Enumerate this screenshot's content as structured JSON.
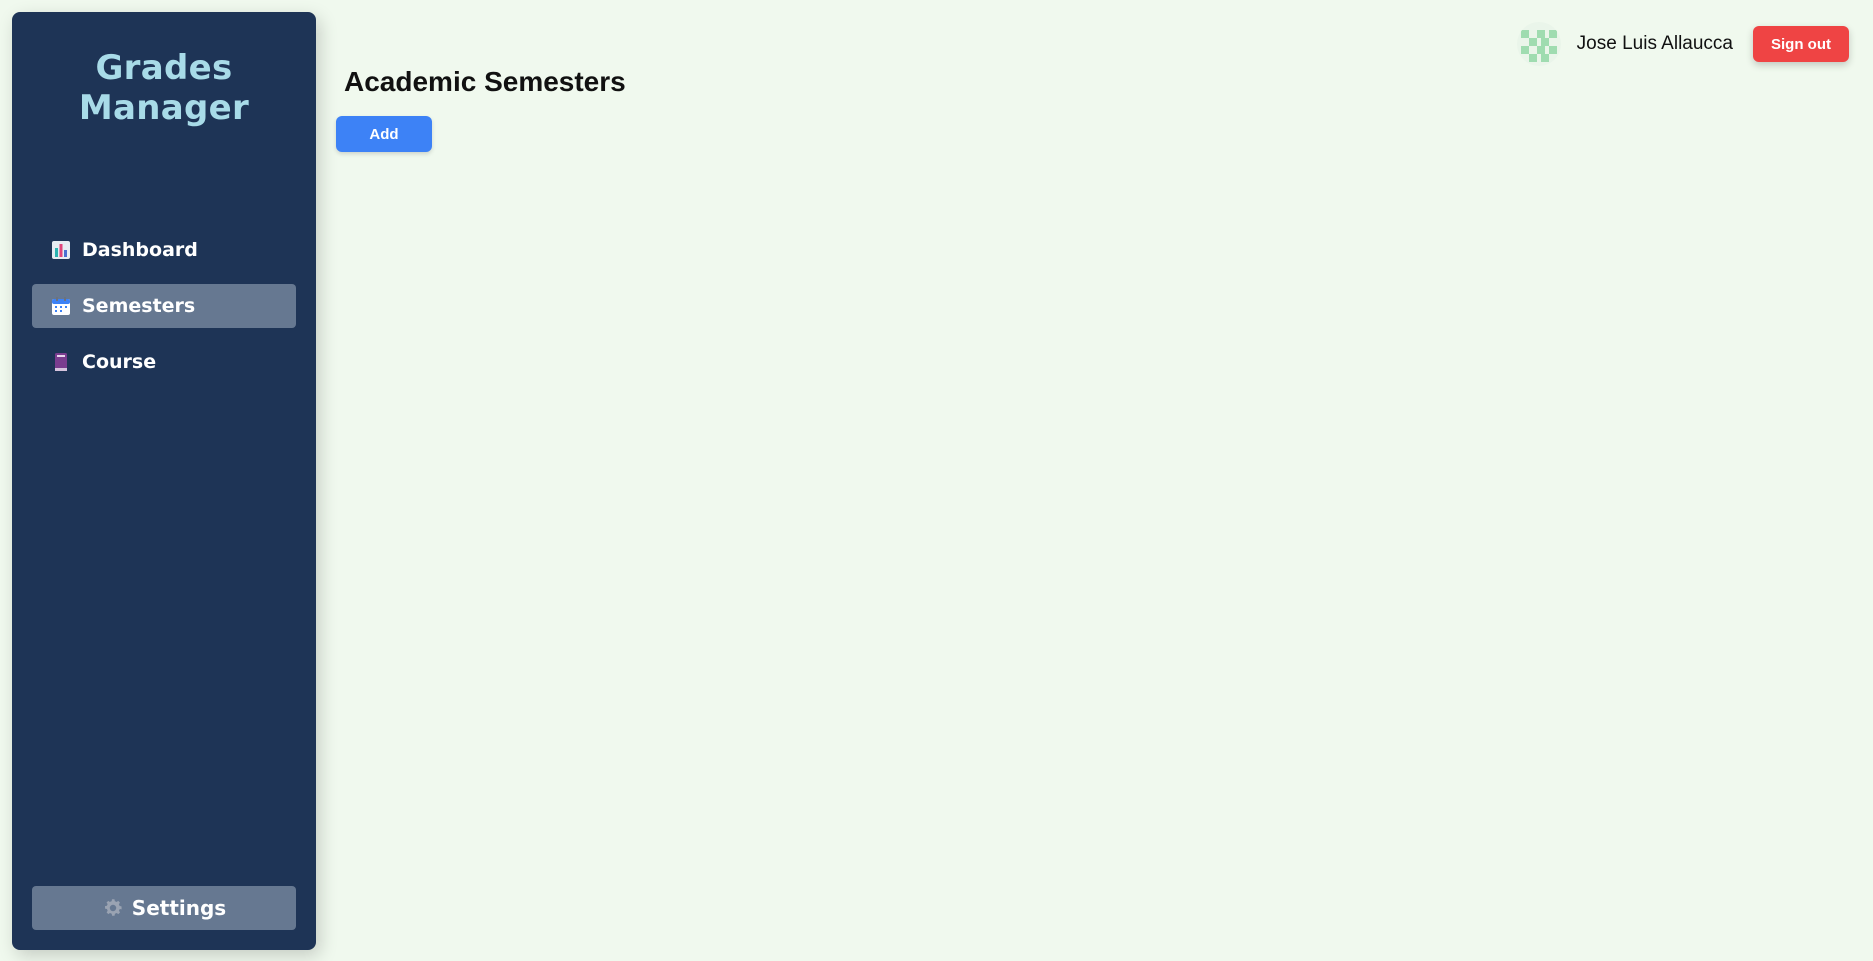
{
  "app": {
    "title": "Grades Manager"
  },
  "sidebar": {
    "items": [
      {
        "label": "Dashboard",
        "icon": "bar-chart-icon",
        "active": false
      },
      {
        "label": "Semesters",
        "icon": "calendar-icon",
        "active": true
      },
      {
        "label": "Course",
        "icon": "book-icon",
        "active": false
      }
    ],
    "settings_label": "Settings",
    "settings_icon": "gear-icon"
  },
  "main": {
    "page_title": "Academic Semesters",
    "add_label": "Add"
  },
  "header": {
    "user_name": "Jose Luis Allaucca",
    "signout_label": "Sign out"
  },
  "colors": {
    "background": "#f0f9ee",
    "sidebar": "#1e3456",
    "brand": "#a8dbe8",
    "active_item": "#667891",
    "primary": "#3d82f6",
    "danger": "#ef4444"
  }
}
